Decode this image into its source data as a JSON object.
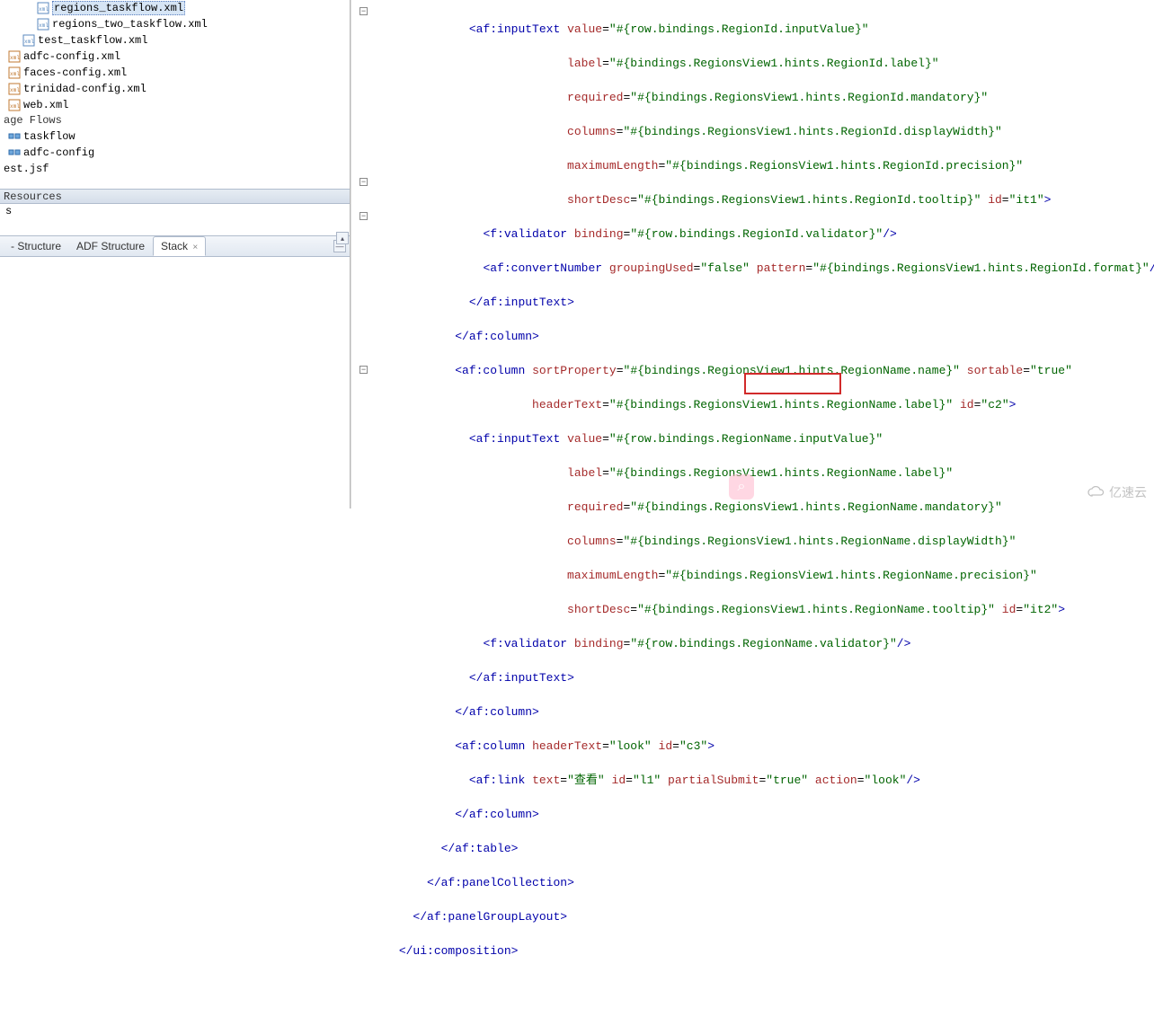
{
  "tree": {
    "items": [
      {
        "label": "regions_taskflow.xml",
        "indent": 2,
        "icon": "xml",
        "selected": true
      },
      {
        "label": "regions_two_taskflow.xml",
        "indent": 2,
        "icon": "xml",
        "selected": false
      },
      {
        "label": "test_taskflow.xml",
        "indent": 1,
        "icon": "xml",
        "selected": false
      },
      {
        "label": "adfc-config.xml",
        "indent": 0,
        "icon": "xml",
        "selected": false
      },
      {
        "label": "faces-config.xml",
        "indent": 0,
        "icon": "xml",
        "selected": false
      },
      {
        "label": "trinidad-config.xml",
        "indent": 0,
        "icon": "xml",
        "selected": false
      },
      {
        "label": "web.xml",
        "indent": 0,
        "icon": "xml",
        "selected": false
      }
    ],
    "page_flows_label": "age Flows",
    "page_flows_items": [
      {
        "label": "taskflow"
      },
      {
        "label": "adfc-config"
      }
    ],
    "est_label": "est.jsf"
  },
  "resources_label": "Resources",
  "resources_sub": "s",
  "structure_tabs": {
    "tab1": "- Structure",
    "tab2": "ADF Structure",
    "tab3": "Stack"
  },
  "code": {
    "l01": {
      "indent": "                ",
      "open": "<",
      "tag": "af:inputText",
      "sp": " ",
      "a1": "value",
      "eq": "=",
      "q": "\"",
      "v1": "#{row.bindings.RegionId.inputValue}"
    },
    "l02": {
      "indent": "                              ",
      "a": "label",
      "v": "#{bindings.RegionsView1.hints.RegionId.label}"
    },
    "l03": {
      "indent": "                              ",
      "a": "required",
      "v": "#{bindings.RegionsView1.hints.RegionId.mandatory}"
    },
    "l04": {
      "indent": "                              ",
      "a": "columns",
      "v": "#{bindings.RegionsView1.hints.RegionId.displayWidth}"
    },
    "l05": {
      "indent": "                              ",
      "a": "maximumLength",
      "v": "#{bindings.RegionsView1.hints.RegionId.precision}"
    },
    "l06": {
      "indent": "                              ",
      "a": "shortDesc",
      "v": "#{bindings.RegionsView1.hints.RegionId.tooltip}",
      "a2": "id",
      "v2": "it1"
    },
    "l07": {
      "indent": "                  ",
      "tag": "f:validator",
      "a": "binding",
      "v": "#{row.bindings.RegionId.validator}"
    },
    "l08": {
      "indent": "                  ",
      "tag": "af:convertNumber",
      "a": "groupingUsed",
      "v": "false",
      "a2": "pattern",
      "v2": "#{bindings.RegionsView1.hints.RegionId.format}"
    },
    "l09": {
      "indent": "                ",
      "close": "</",
      "tag": "af:inputText"
    },
    "l10": {
      "indent": "              ",
      "close": "</",
      "tag": "af:column"
    },
    "l11": {
      "indent": "              ",
      "tag": "af:column",
      "a": "sortProperty",
      "v": "#{bindings.RegionsView1.hints.RegionName.name}",
      "a2": "sortable",
      "v2": "true"
    },
    "l12": {
      "indent": "                         ",
      "a": "headerText",
      "v": "#{bindings.RegionsView1.hints.RegionName.label}",
      "a2": "id",
      "v2": "c2"
    },
    "l13": {
      "indent": "                ",
      "tag": "af:inputText",
      "a": "value",
      "v": "#{row.bindings.RegionName.inputValue}"
    },
    "l14": {
      "indent": "                              ",
      "a": "label",
      "v": "#{bindings.RegionsView1.hints.RegionName.label}"
    },
    "l15": {
      "indent": "                              ",
      "a": "required",
      "v": "#{bindings.RegionsView1.hints.RegionName.mandatory}"
    },
    "l16": {
      "indent": "                              ",
      "a": "columns",
      "v": "#{bindings.RegionsView1.hints.RegionName.displayWidth}"
    },
    "l17": {
      "indent": "                              ",
      "a": "maximumLength",
      "v": "#{bindings.RegionsView1.hints.RegionName.precision}"
    },
    "l18": {
      "indent": "                              ",
      "a": "shortDesc",
      "v": "#{bindings.RegionsView1.hints.RegionName.tooltip}",
      "a2": "id",
      "v2": "it2"
    },
    "l19": {
      "indent": "                  ",
      "tag": "f:validator",
      "a": "binding",
      "v": "#{row.bindings.RegionName.validator}"
    },
    "l20": {
      "indent": "                ",
      "close": "</",
      "tag": "af:inputText"
    },
    "l21": {
      "indent": "              ",
      "close": "</",
      "tag": "af:column"
    },
    "l22": {
      "indent": "              ",
      "tag": "af:column",
      "a": "headerText",
      "v": "look",
      "a2": "id",
      "v2": "c3"
    },
    "l23": {
      "indent": "                ",
      "tag": "af:link",
      "a": "text",
      "v": "查看",
      "a2": "id",
      "v2": "l1",
      "a3": "partialSubmit",
      "v3": "true",
      "a4": "action",
      "v4": "look"
    },
    "l24": {
      "indent": "              ",
      "close": "</",
      "tag": "af:column"
    },
    "l25": {
      "indent": "            ",
      "close": "</",
      "tag": "af:table"
    },
    "l26": {
      "indent": "          ",
      "close": "</",
      "tag": "af:panelCollection"
    },
    "l27": {
      "indent": "        ",
      "close": "</",
      "tag": "af:panelGroupLayout"
    },
    "l28": {
      "indent": "      ",
      "close": "</",
      "tag": "ui:composition"
    }
  },
  "watermark_text": "亿速云",
  "icons": {
    "fold_minus": "−",
    "chevron_up": "▴",
    "close_x": "×",
    "search": "⌕"
  }
}
